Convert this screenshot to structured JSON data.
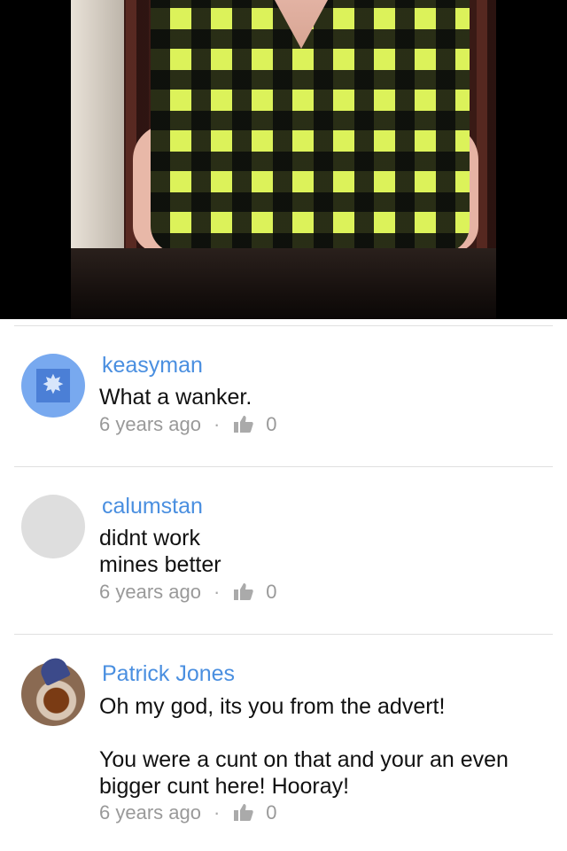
{
  "video": {
    "icon": "video-frame"
  },
  "comments": [
    {
      "username": "keasyman",
      "text": "What a wanker.",
      "age": "6 years ago",
      "separator": "·",
      "likes": "0",
      "avatar": "blue-pattern-avatar"
    },
    {
      "username": "calumstan",
      "text": "didnt work\nmines better",
      "age": "6 years ago",
      "separator": "·",
      "likes": "0",
      "avatar": "blank-grey-avatar"
    },
    {
      "username": "Patrick Jones",
      "text": "Oh my god, its you from the advert!\n\nYou were a cunt on that and your an even bigger cunt here! Hooray!",
      "age": "6 years ago",
      "separator": "·",
      "likes": "0",
      "avatar": "photo-avatar"
    }
  ],
  "colors": {
    "username": "#4a8fe0",
    "meta": "#999999",
    "separator_line": "#e0e0e0"
  }
}
